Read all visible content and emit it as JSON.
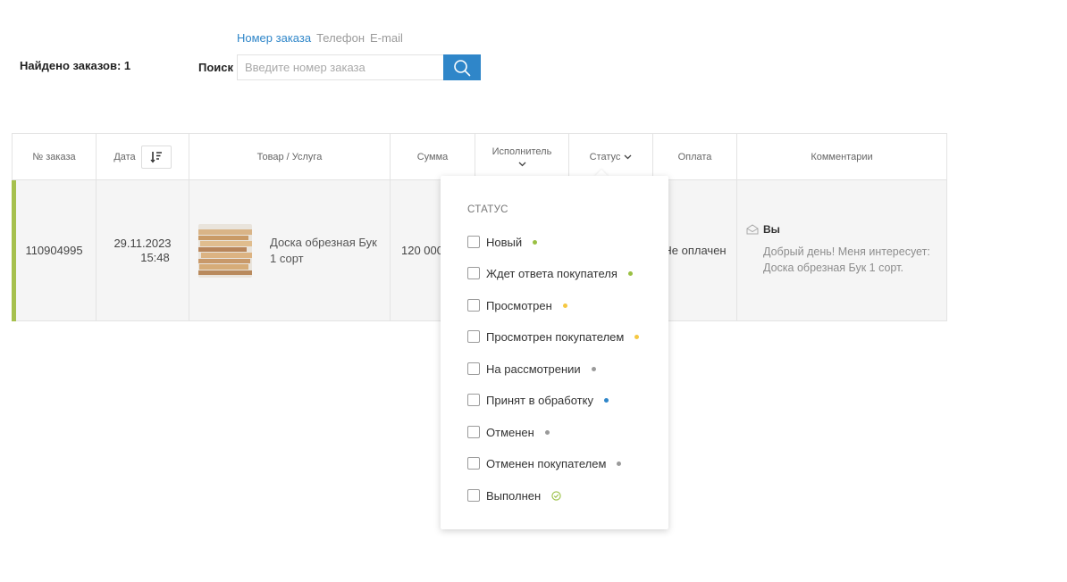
{
  "summary": {
    "found_label": "Найдено заказов: 1"
  },
  "search": {
    "tabs": [
      {
        "label": "Номер заказа",
        "active": true
      },
      {
        "label": "Телефон",
        "active": false
      },
      {
        "label": "E-mail",
        "active": false
      }
    ],
    "label": "Поиск",
    "placeholder": "Введите номер заказа",
    "value": ""
  },
  "table": {
    "headers": {
      "order_no": "№ заказа",
      "date": "Дата",
      "product": "Товар / Услуга",
      "sum": "Сумма",
      "executor": "Исполнитель",
      "status": "Статус",
      "payment": "Оплата",
      "comments": "Комментарии"
    },
    "rows": [
      {
        "order_no": "110904995",
        "date": "29.11.2023",
        "time": "15:48",
        "product": "Доска обрезная Бук 1 сорт",
        "sum": "120 000",
        "payment": "Не оплачен",
        "comment_author": "Вы",
        "comment_text": "Добрый день! Меня интересует: Доска обрезная Бук 1 сорт."
      }
    ]
  },
  "status_dropdown": {
    "title": "СТАТУС",
    "items": [
      {
        "label": "Новый",
        "color": "#9ac043"
      },
      {
        "label": "Ждет ответа покупателя",
        "color": "#9ac043"
      },
      {
        "label": "Просмотрен",
        "color": "#f5c842"
      },
      {
        "label": "Просмотрен покупателем",
        "color": "#f5c842"
      },
      {
        "label": "На рассмотрении",
        "color": "#9a9a9a"
      },
      {
        "label": "Принят в обработку",
        "color": "#2f86c9"
      },
      {
        "label": "Отменен",
        "color": "#9a9a9a"
      },
      {
        "label": "Отменен покупателем",
        "color": "#9a9a9a"
      },
      {
        "label": "Выполнен",
        "color": "#9ac043",
        "icon": "check-circle-icon"
      }
    ]
  },
  "colors": {
    "accent": "#2f86c9",
    "row_marker": "#a6c04d"
  }
}
